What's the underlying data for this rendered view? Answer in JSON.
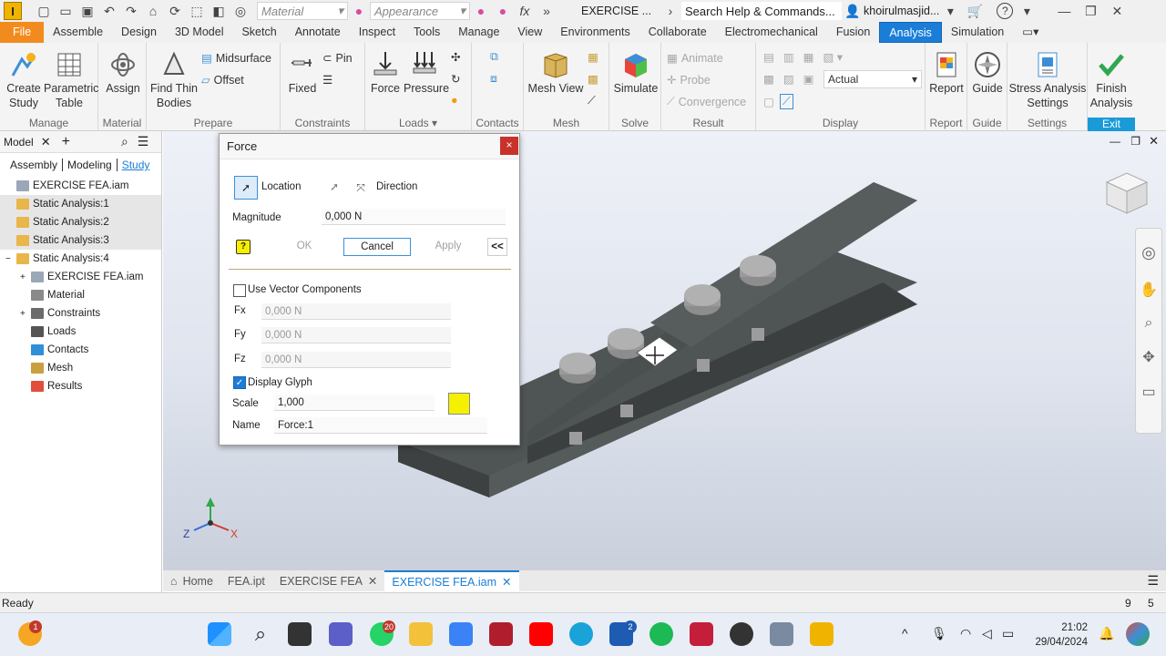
{
  "titlebar": {
    "logo": "I",
    "material_placeholder": "Material",
    "appearance_placeholder": "Appearance",
    "doc_title": "EXERCISE ...",
    "search_placeholder": "Search Help & Commands...",
    "user": "khoirulmasjid...",
    "help": "?"
  },
  "menu": {
    "items": [
      "File",
      "Assemble",
      "Design",
      "3D Model",
      "Sketch",
      "Annotate",
      "Inspect",
      "Tools",
      "Manage",
      "View",
      "Environments",
      "Collaborate",
      "Electromechanical",
      "Fusion",
      "Analysis",
      "Simulation"
    ],
    "active": "Analysis"
  },
  "ribbon": {
    "manage": {
      "title": "Manage",
      "create_study": "Create\nStudy",
      "parametric_table": "Parametric\nTable"
    },
    "material": {
      "title": "Material",
      "assign": "Assign"
    },
    "prepare": {
      "title": "Prepare",
      "find_thin": "Find Thin\nBodies",
      "midsurface": "Midsurface",
      "offset": "Offset"
    },
    "constraints": {
      "title": "Constraints",
      "fixed": "Fixed",
      "pin": "Pin"
    },
    "loads": {
      "title": "Loads",
      "force": "Force",
      "pressure": "Pressure"
    },
    "contacts": {
      "title": "Contacts"
    },
    "mesh": {
      "title": "Mesh",
      "mesh_view": "Mesh View"
    },
    "solve": {
      "title": "Solve",
      "simulate": "Simulate"
    },
    "result": {
      "title": "Result",
      "animate": "Animate",
      "probe": "Probe",
      "convergence": "Convergence"
    },
    "display": {
      "title": "Display",
      "actual": "Actual"
    },
    "report": {
      "title": "Report",
      "report": "Report"
    },
    "guide": {
      "title": "Guide",
      "guide": "Guide"
    },
    "settings": {
      "title": "Settings",
      "stress_settings": "Stress Analysis\nSettings"
    },
    "exit": {
      "title": "Exit",
      "finish": "Finish\nAnalysis"
    }
  },
  "browser": {
    "title": "Model",
    "tabs": [
      "Assembly",
      "Modeling",
      "Study"
    ],
    "active_tab": "Study",
    "tree": [
      {
        "label": "EXERCISE FEA.iam",
        "level": 0,
        "color": "#9aa7b8"
      },
      {
        "label": "Static Analysis:1",
        "level": 0,
        "color": "#e8b64a"
      },
      {
        "label": "Static Analysis:2",
        "level": 0,
        "color": "#e8b64a"
      },
      {
        "label": "Static Analysis:3",
        "level": 0,
        "color": "#e8b64a"
      },
      {
        "label": "Static Analysis:4",
        "level": 0,
        "color": "#e8b64a"
      },
      {
        "label": "EXERCISE FEA.iam",
        "level": 1,
        "color": "#9aa7b8"
      },
      {
        "label": "Material",
        "level": 1,
        "color": "#8a8a8a"
      },
      {
        "label": "Constraints",
        "level": 1,
        "color": "#6b6b6b"
      },
      {
        "label": "Loads",
        "level": 1,
        "color": "#555"
      },
      {
        "label": "Contacts",
        "level": 1,
        "color": "#2f8fd8"
      },
      {
        "label": "Mesh",
        "level": 1,
        "color": "#c9a040"
      },
      {
        "label": "Results",
        "level": 1,
        "color": "#e24d3d"
      }
    ]
  },
  "dialog": {
    "title": "Force",
    "close": "×",
    "location": "Location",
    "direction": "Direction",
    "magnitude_label": "Magnitude",
    "magnitude_value": "0,000 N",
    "ok": "OK",
    "cancel": "Cancel",
    "apply": "Apply",
    "collapse": "<<",
    "use_vector": "Use Vector Components",
    "fx_label": "Fx",
    "fy_label": "Fy",
    "fz_label": "Fz",
    "fx": "0,000 N",
    "fy": "0,000 N",
    "fz": "0,000 N",
    "display_glyph": "Display Glyph",
    "scale_label": "Scale",
    "scale_value": "1,000",
    "name_label": "Name",
    "name_value": "Force:1",
    "glyph_color": "#f5f000"
  },
  "doctabs": {
    "home": "Home",
    "tabs": [
      "FEA.ipt",
      "EXERCISE FEA",
      "EXERCISE FEA.iam"
    ]
  },
  "status": {
    "text": "Ready",
    "n1": "9",
    "n2": "5"
  },
  "taskbar": {
    "time": "21:02",
    "date": "29/04/2024",
    "badge_whatsapp": "20",
    "badge_l": "2",
    "badge_weather": "1"
  },
  "colors": {
    "accent": "#1a7dd7",
    "file_tab": "#f28b1e",
    "part": "#4a4f50",
    "bolt": "#8f8f8f"
  }
}
